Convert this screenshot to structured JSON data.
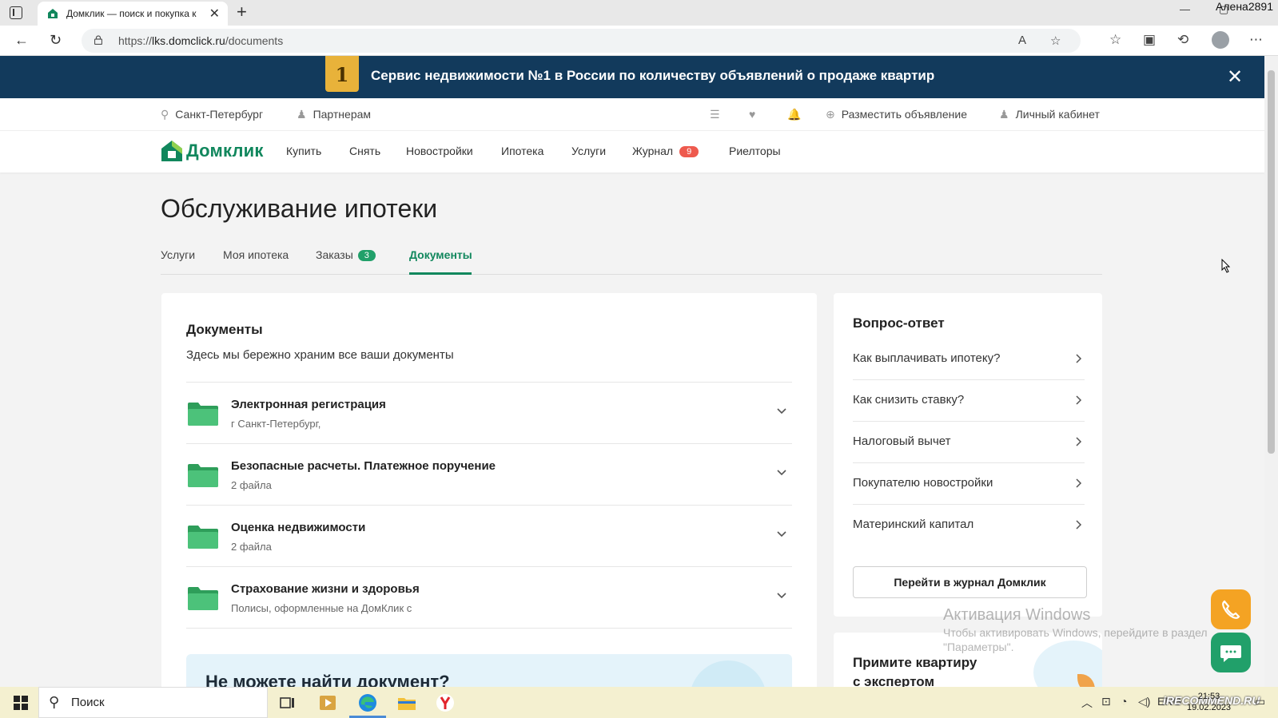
{
  "browser": {
    "tab_title": "Домклик — поиск и покупка к",
    "tab_close": "✕",
    "new_tab": "+",
    "user_name": "Алена2891",
    "url_prefix": "https://",
    "url_host": "lks.domclick.ru",
    "url_path": "/documents"
  },
  "promo": {
    "badge": "1",
    "text": "Сервис недвижимости №1 в России по количеству объявлений о продаже квартир",
    "close": "✕"
  },
  "topline": {
    "city": "Санкт-Петербург",
    "partners": "Партнерам",
    "post_ad": "Разместить объявление",
    "cabinet": "Личный кабинет"
  },
  "nav": {
    "logo": "Домклик",
    "items": [
      "Купить",
      "Снять",
      "Новостройки",
      "Ипотека",
      "Услуги",
      "Журнал",
      "Риелторы"
    ],
    "journal_badge": "9"
  },
  "page": {
    "title": "Обслуживание ипотеки",
    "tabs": [
      "Услуги",
      "Моя ипотека",
      "Заказы",
      "Документы"
    ],
    "orders_badge": "3",
    "active_tab": "Документы"
  },
  "documents": {
    "title": "Документы",
    "subtitle": "Здесь мы бережно храним все ваши документы",
    "rows": [
      {
        "name": "Электронная регистрация",
        "meta": "г Санкт-Петербург,"
      },
      {
        "name": "Безопасные расчеты. Платежное поручение",
        "meta": "2 файла"
      },
      {
        "name": "Оценка недвижимости",
        "meta": "2 файла"
      },
      {
        "name": "Страхование жизни и здоровья",
        "meta": "Полисы, оформленные на ДомКлик с"
      }
    ],
    "not_found": "Не можете найти документ?"
  },
  "faq": {
    "title": "Вопрос-ответ",
    "items": [
      "Как выплачивать ипотеку?",
      "Как снизить ставку?",
      "Налоговый вычет",
      "Покупателю новостройки",
      "Материнский капитал"
    ],
    "button": "Перейти в журнал Домклик"
  },
  "expert": {
    "line1": "Примите квартиру",
    "line2": "с экспертом"
  },
  "watermark": {
    "line1": "Активация Windows",
    "line2": "Чтобы активировать Windows, перейдите в раздел",
    "line3": "\"Параметры\"."
  },
  "taskbar": {
    "search": "Поиск",
    "lang": "ENG",
    "time": "21:53",
    "date": "19.02.2023",
    "watermark": "iRECOMMEND.RU"
  },
  "colors": {
    "brand_green": "#11875d",
    "promo_bg": "#123a5c",
    "badge_red": "#ee5a4e",
    "folder_green": "#3fb86c"
  }
}
